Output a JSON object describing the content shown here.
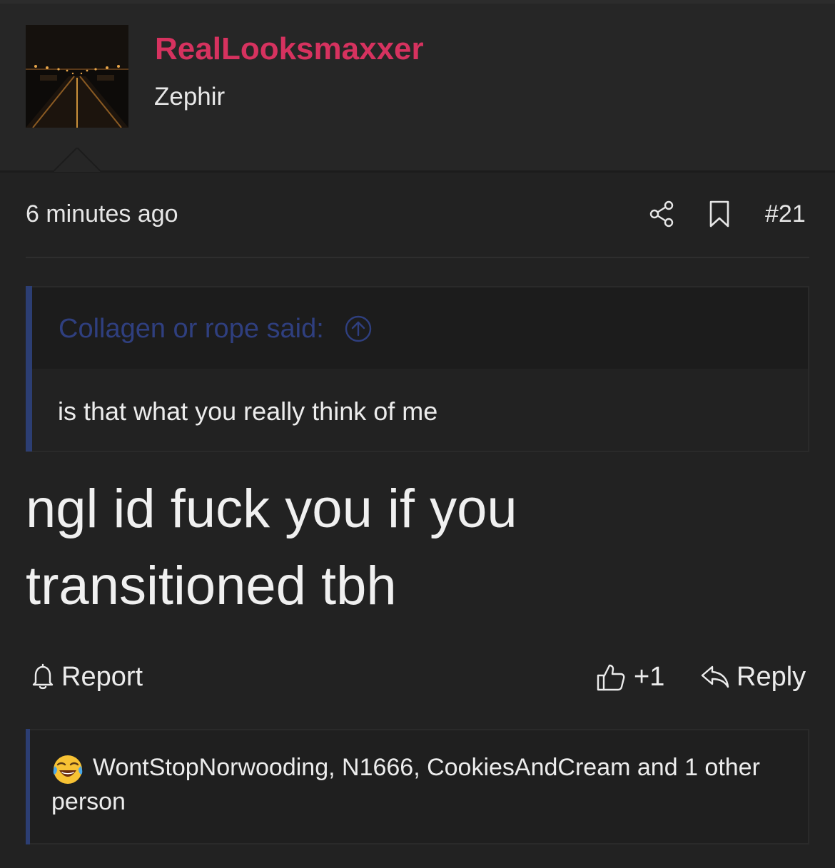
{
  "post": {
    "username": "RealLooksmaxxer",
    "user_title": "Zephir",
    "timestamp": "6 minutes ago",
    "post_number": "#21",
    "avatar_icon": "night-tunnel-avatar",
    "message": "ngl id fuck you if you transitioned tbh"
  },
  "quote": {
    "author_label": "Collagen or rope said:",
    "text": "is that what you really think of me",
    "up_icon": "arrow-up-circle-icon"
  },
  "actions": {
    "report_label": "Report",
    "like_count": "+1",
    "reply_label": "Reply"
  },
  "reactions": {
    "emoji_icon": "laughing-crying-face-icon",
    "text": "WontStopNorwooding, N1666, CookiesAndCream and 1 other person"
  },
  "colors": {
    "username": "#d6325f",
    "quote_accent": "#2c3e73",
    "background": "#222222"
  }
}
